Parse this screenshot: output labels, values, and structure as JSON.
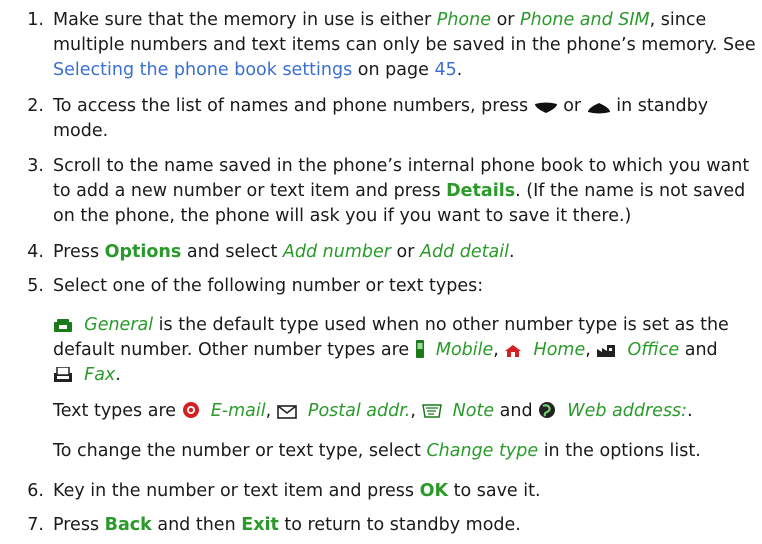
{
  "steps": {
    "s1": {
      "num": "1.",
      "t1": "Make sure that the memory in use is either ",
      "phone": "Phone",
      "t2": " or ",
      "phone_sim": "Phone and SIM",
      "t3": ", since multiple numbers and text items can only be saved in the phone’s memory. See ",
      "link": "Selecting the phone book settings",
      "t4": " on page ",
      "page": "45",
      "t5": "."
    },
    "s2": {
      "num": "2.",
      "t1": "To access the list of names and phone numbers, press ",
      "t2": " or ",
      "t3": " in standby mode.",
      "icon_down": "scroll-down-key-icon",
      "icon_up": "scroll-up-key-icon"
    },
    "s3": {
      "num": "3.",
      "t1": "Scroll to the name saved in the phone’s internal phone book to which you want to add a new number or text item and press ",
      "details": "Details",
      "t2": ". (If the name is not saved on the phone, the phone will ask you if you want to save it there.)"
    },
    "s4": {
      "num": "4.",
      "t1": "Press ",
      "options": "Options",
      "t2": " and select ",
      "add_number": "Add number",
      "t3": " or ",
      "add_detail": "Add detail",
      "t4": "."
    },
    "s5": {
      "num": "5.",
      "t1": "Select one of the following number or text types:",
      "p1": {
        "general": "General",
        "t1": " is the default type used when no other number type is set as the default number. Other number types are ",
        "mobile": "Mobile",
        "home": "Home",
        "office": "Office",
        "fax": "Fax",
        "and": " and ",
        "comma": ", ",
        "end": "."
      },
      "p2": {
        "t1": "Text types are ",
        "email": "E-mail",
        "postal": "Postal addr.",
        "note": "Note",
        "web": "Web address:",
        "and": " and ",
        "comma": ", ",
        "end": "."
      },
      "p3": {
        "t1": "To change the number or text type, select ",
        "change": "Change type",
        "t2": " in the options list."
      }
    },
    "s6": {
      "num": "6.",
      "t1": "Key in the number or text item and press ",
      "ok": "OK",
      "t2": " to save it."
    },
    "s7": {
      "num": "7.",
      "t1": "Press ",
      "back": "Back",
      "t2": " and then ",
      "exit": "Exit",
      "t3": " to return to standby mode."
    }
  },
  "colors": {
    "accent_green": "#2a9a2a",
    "link_blue": "#3a6fd0",
    "text": "#1a1a1a"
  },
  "icons": [
    "general-number-icon",
    "mobile-number-icon",
    "home-number-icon",
    "office-number-icon",
    "fax-number-icon",
    "email-icon",
    "postal-address-icon",
    "note-icon",
    "web-address-icon"
  ]
}
